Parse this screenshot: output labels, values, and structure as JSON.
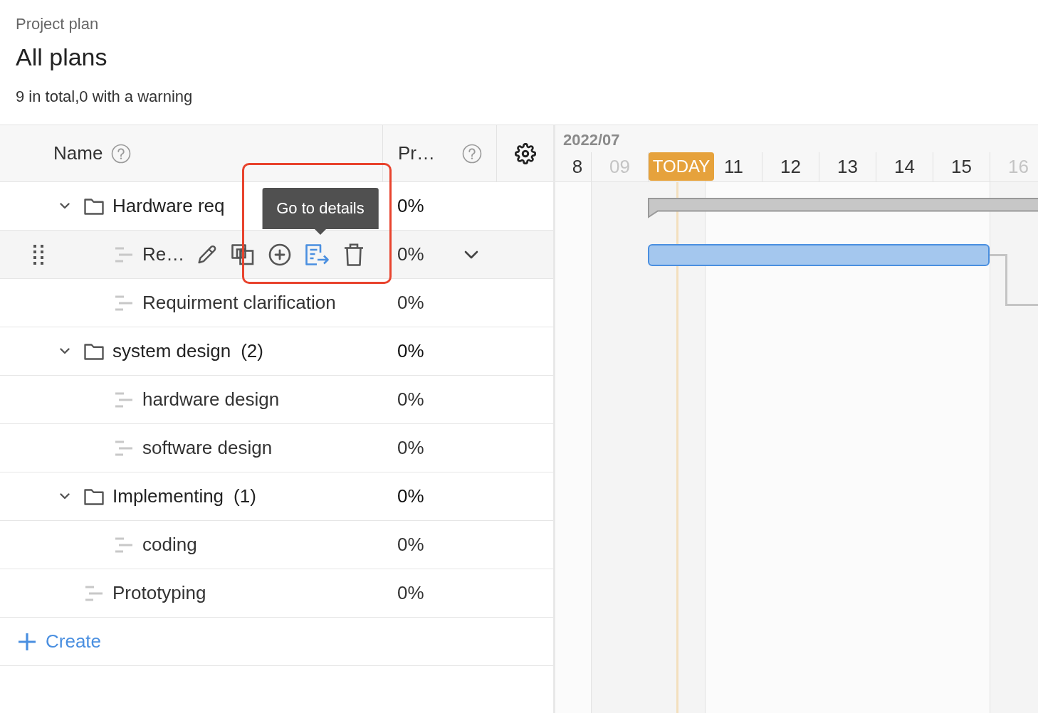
{
  "header": {
    "breadcrumb": "Project plan",
    "title": "All plans",
    "summary": "9 in total,0 with a warning"
  },
  "table": {
    "columns": [
      {
        "label": "Name",
        "kind": "name"
      },
      {
        "label": "Pr…",
        "kind": "progress"
      }
    ],
    "rows": [
      {
        "kind": "group",
        "name": "Hardware req",
        "progress": "0%",
        "expanded": true,
        "hovered": false,
        "bar": {
          "kind": "summary"
        },
        "children": [
          {
            "kind": "task",
            "name": "Re…",
            "progress": "0%",
            "hovered": true,
            "tooltip": "Go to details",
            "highlighted": true,
            "bar": {
              "kind": "task",
              "linked": true
            }
          },
          {
            "kind": "task",
            "name": "Requirment clarification",
            "progress": "0%",
            "hovered": false
          }
        ]
      },
      {
        "kind": "group",
        "name": "system design",
        "count": "(2)",
        "progress": "0%",
        "expanded": true,
        "hovered": false,
        "children": [
          {
            "kind": "task",
            "name": "hardware design",
            "progress": "0%",
            "hovered": false
          },
          {
            "kind": "task",
            "name": "software design",
            "progress": "0%",
            "hovered": false
          }
        ]
      },
      {
        "kind": "group",
        "name": "Implementing",
        "count": "(1)",
        "progress": "0%",
        "expanded": true,
        "hovered": false,
        "children": [
          {
            "kind": "task",
            "name": "coding",
            "progress": "0%",
            "hovered": false
          }
        ]
      },
      {
        "kind": "task",
        "name": "Prototyping",
        "progress": "0%",
        "hovered": false
      }
    ],
    "create_label": "Create"
  },
  "timeline": {
    "month": "2022/07",
    "days": [
      {
        "label": "8",
        "weekend": false,
        "today": false
      },
      {
        "label": "09",
        "weekend": true,
        "today": false
      },
      {
        "label": "TODAY",
        "weekend": true,
        "today": true
      },
      {
        "label": "11",
        "weekend": false,
        "today": false
      },
      {
        "label": "12",
        "weekend": false,
        "today": false
      },
      {
        "label": "13",
        "weekend": false,
        "today": false
      },
      {
        "label": "14",
        "weekend": false,
        "today": false
      },
      {
        "label": "15",
        "weekend": false,
        "today": false
      },
      {
        "label": "16",
        "weekend": true,
        "today": false
      }
    ]
  }
}
